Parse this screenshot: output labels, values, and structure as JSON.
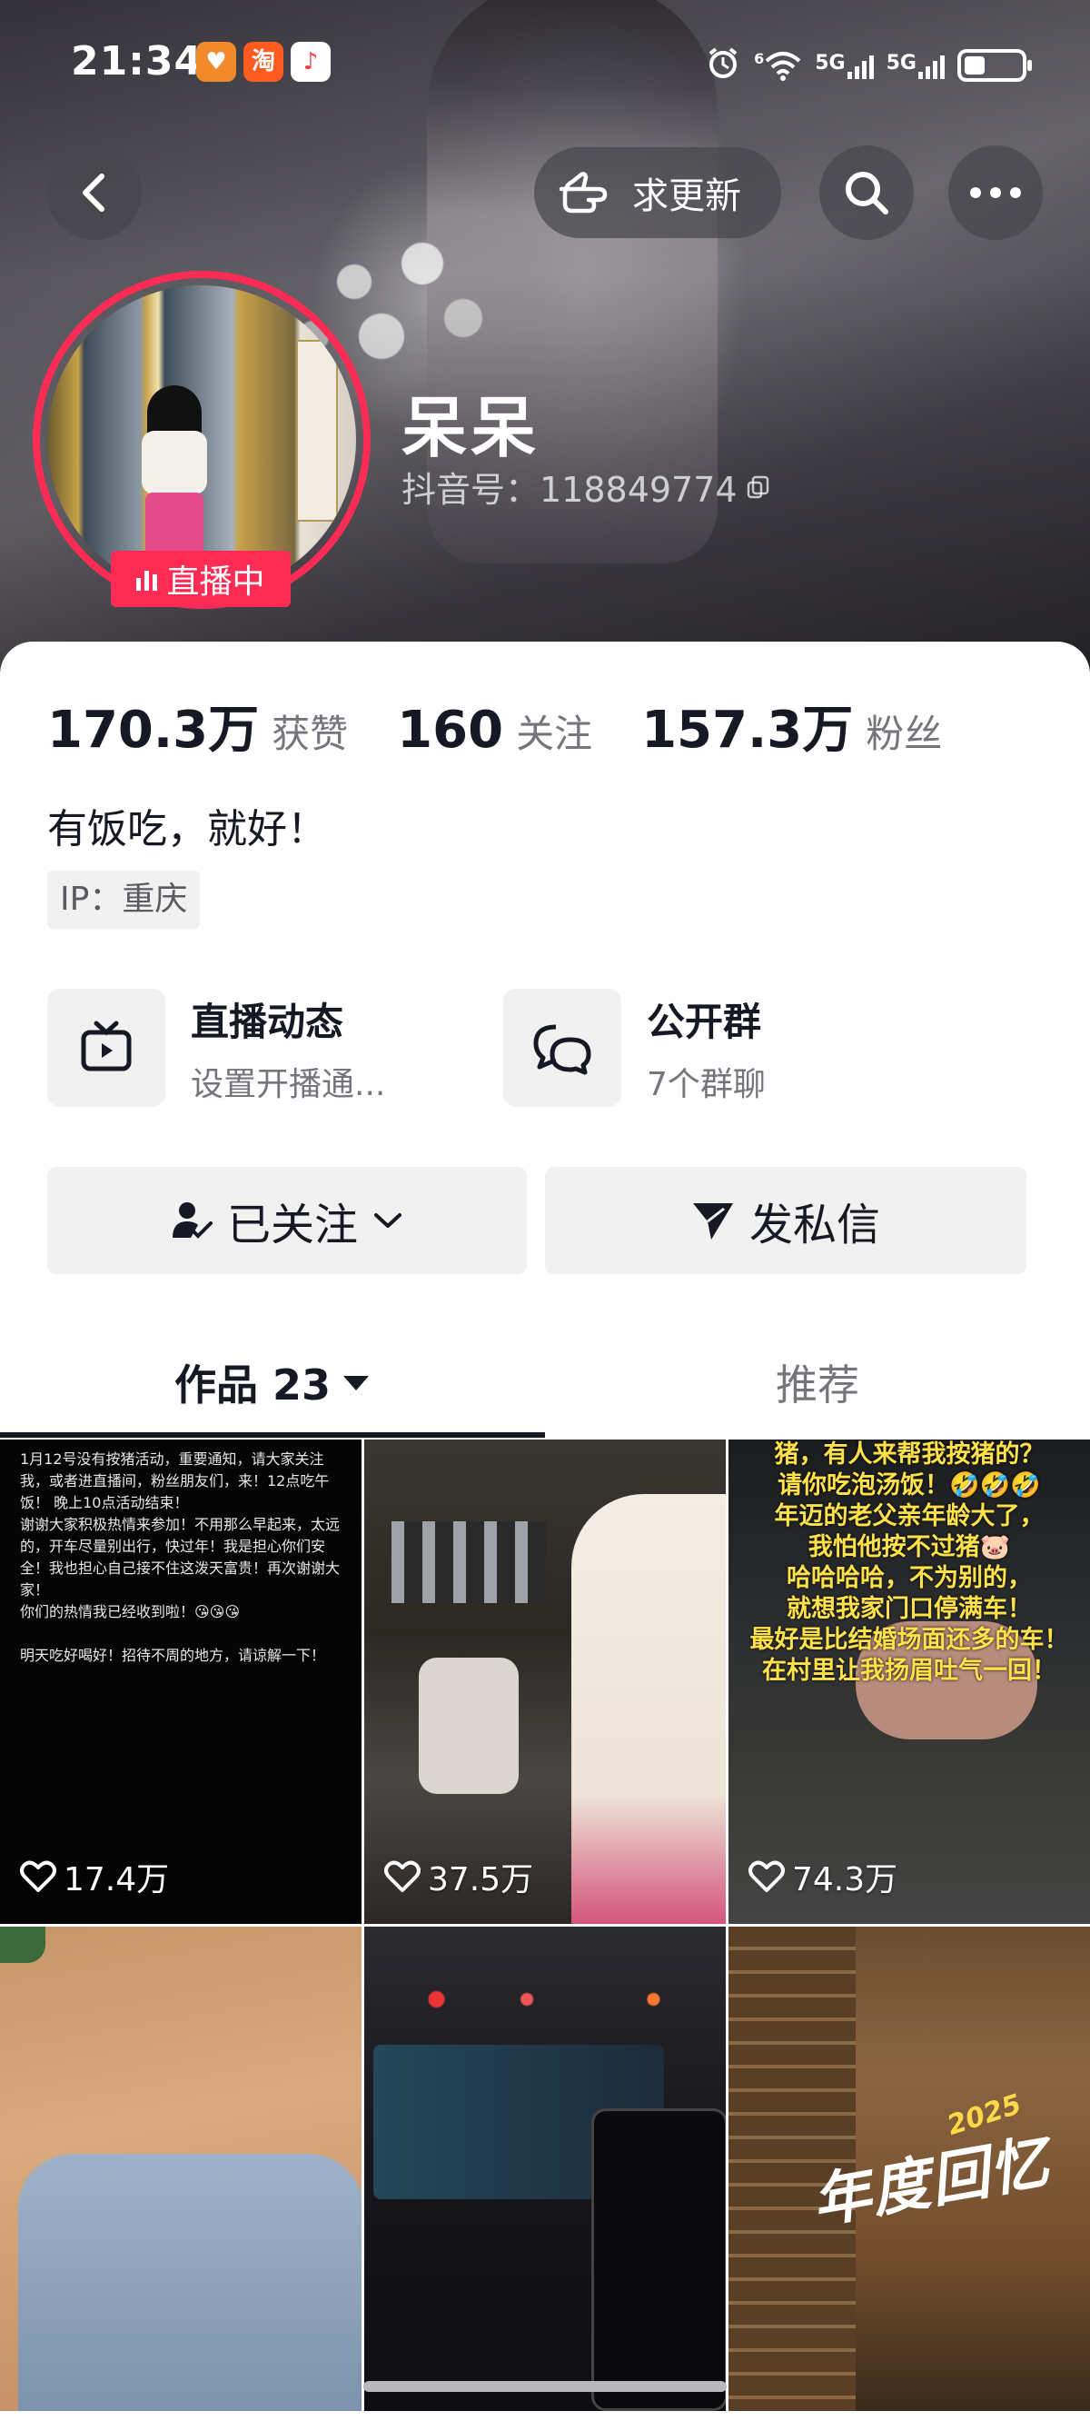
{
  "status_bar": {
    "time": "21:34",
    "network_label": "5G",
    "network_label_2": "5G",
    "wifi_label": "6"
  },
  "nav": {
    "update_label": "求更新"
  },
  "profile": {
    "nickname": "呆呆",
    "douyin_id": "抖音号：118849774",
    "live_badge": "直播中"
  },
  "stats": [
    {
      "value": "170.3万",
      "label": "获赞"
    },
    {
      "value": "160",
      "label": "关注"
    },
    {
      "value": "157.3万",
      "label": "粉丝"
    }
  ],
  "bio": "有饭吃，就好！",
  "ip": "IP：重庆",
  "entries": [
    {
      "title": "直播动态",
      "subtitle": "设置开播通..."
    },
    {
      "title": "公开群",
      "subtitle": "7个群聊"
    }
  ],
  "actions": {
    "followed": "已关注",
    "message": "发私信"
  },
  "tabs": {
    "works": "作品 23",
    "recommend": "推荐"
  },
  "videos": [
    {
      "likes": "17.4万",
      "text": "1月12号没有按猪活动，重要通知，请大家关注我，或者进直播间，粉丝朋友们，来！12点吃午饭！ 晚上10点活动结束！\n  谢谢大家积极热情来参加！不用那么早起来，太远的，开车尽量别出行，快过年！我是担心你们安全！我也担心自己接不住这泼天富贵！再次谢谢大家！\n你们的热情我已经收到啦！😘😘😘\n\n  明天吃好喝好！招待不周的地方，请谅解一下！"
    },
    {
      "likes": "37.5万"
    },
    {
      "likes": "74.3万",
      "caption": "猪，有人来帮我按猪的？\n请你吃泡汤饭！🤣🤣🤣\n年迈的老父亲年龄大了，\n我怕他按不过猪🐷\n哈哈哈哈，不为别的，\n就想我家门口停满车！\n最好是比结婚场面还多的车！\n在村里让我扬眉吐气一回！"
    },
    {
      "likes": ""
    },
    {
      "likes": ""
    },
    {
      "likes": "",
      "title": "年度回忆",
      "year": "2025"
    }
  ]
}
